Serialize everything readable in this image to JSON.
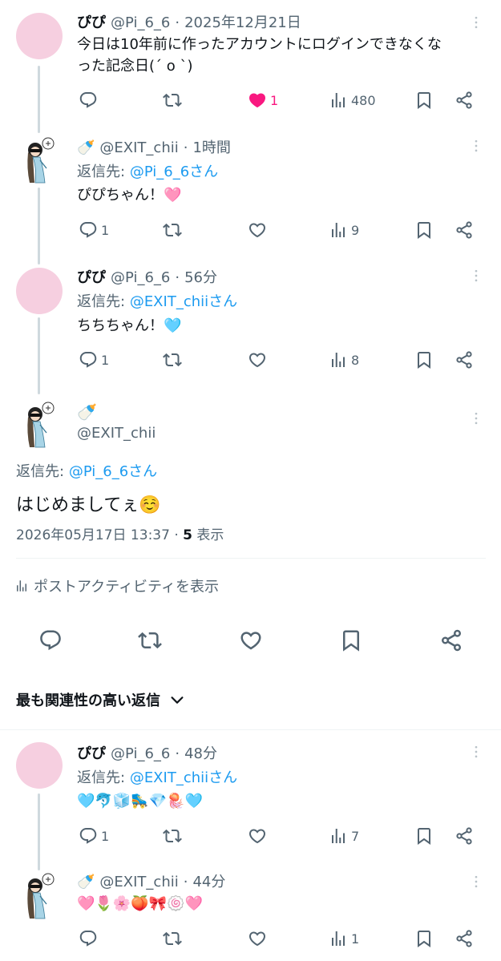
{
  "colors": {
    "accent": "#1d9bf0",
    "like": "#f91880",
    "muted": "#536471",
    "avatar_pink": "#f6cfe0"
  },
  "post1": {
    "name": "ぴぴ",
    "handle": "@Pi_6_6",
    "dot": "·",
    "time": "2025年12月21日",
    "text_line1": "今日は10年前に作ったアカウントにログインできなくな",
    "text_line2": "った記念日(ˊ o ˋ)",
    "replies": "",
    "reposts": "",
    "likes": "1",
    "views": "480",
    "liked": true
  },
  "post2": {
    "name": "🍼",
    "handle": "@EXIT_chii",
    "dot": "·",
    "time": "1時間",
    "reply_label": "返信先:",
    "reply_target": "@Pi_6_6さん",
    "text": "ぴぴちゃん！🩷",
    "replies": "1",
    "reposts": "",
    "likes": "",
    "views": "9"
  },
  "post3": {
    "name": "ぴぴ",
    "handle": "@Pi_6_6",
    "dot": "·",
    "time": "56分",
    "reply_label": "返信先:",
    "reply_target": "@EXIT_chiiさん",
    "text": "ちちちゃん！🩵",
    "replies": "1",
    "reposts": "",
    "likes": "",
    "views": "8"
  },
  "main_post": {
    "name": "🍼",
    "handle": "@EXIT_chii",
    "reply_label": "返信先:",
    "reply_target": "@Pi_6_6さん",
    "text": "はじめましてぇ☺️",
    "timestamp": "2026年05月17日 13:37",
    "dot": "·",
    "views_count": "5",
    "views_label": "表示",
    "activity_label": "ポストアクティビティを表示"
  },
  "sort": {
    "label": "最も関連性の高い返信"
  },
  "post4": {
    "name": "ぴぴ",
    "handle": "@Pi_6_6",
    "dot": "·",
    "time": "48分",
    "reply_label": "返信先:",
    "reply_target": "@EXIT_chiiさん",
    "text": "🩵🐬🧊🛼💎🪼🩵",
    "replies": "1",
    "reposts": "",
    "likes": "",
    "views": "7"
  },
  "post5": {
    "name": "🍼",
    "handle": "@EXIT_chii",
    "dot": "·",
    "time": "44分",
    "text": "🩷🌷🌸🍑🎀🍥🩷",
    "replies": "",
    "reposts": "",
    "likes": "",
    "views": "1"
  }
}
